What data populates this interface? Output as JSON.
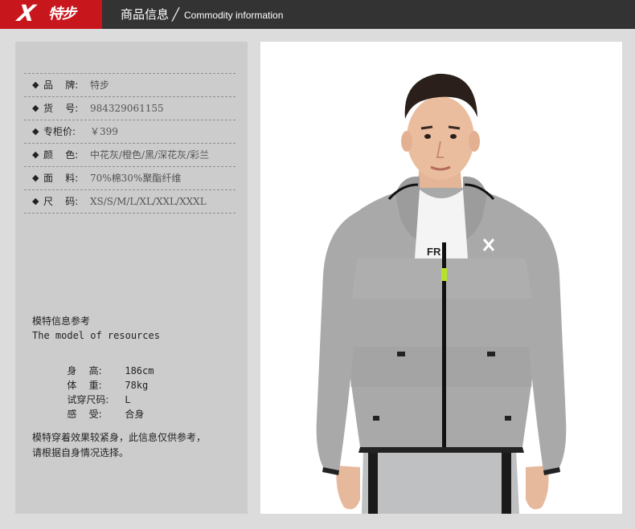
{
  "header": {
    "brand_mark": "X",
    "brand_text": "特步",
    "title_cn": "商品信息",
    "separator": "╱",
    "title_en": "Commodity information"
  },
  "specs": [
    {
      "label": "品    牌:",
      "value": "特步"
    },
    {
      "label": "货    号:",
      "value": "984329061155"
    },
    {
      "label": "专柜价:",
      "value": "￥399"
    },
    {
      "label": "颜    色:",
      "value": "中花灰/橙色/黑/深花灰/彩兰"
    },
    {
      "label": "面    料:",
      "value": "70%棉30%聚酯纤维"
    },
    {
      "label": "尺    码:",
      "value": "XS/S/M/L/XL/XXL/XXXL"
    }
  ],
  "model": {
    "title": "模特信息参考",
    "subtitle": "The model of resources",
    "rows": [
      {
        "label": "身    高:",
        "value": "186cm"
      },
      {
        "label": "体    重:",
        "value": "78kg"
      },
      {
        "label": "试穿尺码:",
        "value": "L"
      },
      {
        "label": "感    受:",
        "value": "合身"
      }
    ],
    "note_line1": "模特穿着效果较紧身，此信息仅供参考，",
    "note_line2": "请根据自身情况选择。"
  },
  "photo": {
    "chest_text": "FR"
  },
  "colors": {
    "header_bg": "#333333",
    "brand_red": "#c8161d",
    "panel_bg": "#cccccc",
    "jacket_grey": "#a9a9a9",
    "zip_accent": "#b7e22a"
  }
}
